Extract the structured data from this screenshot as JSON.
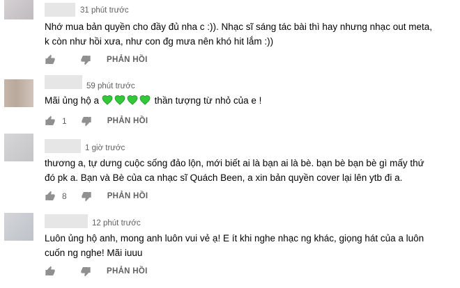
{
  "comments": [
    {
      "time": "31 phút trước",
      "lines": [
        "Nhớ mua bản quyền cho đầy đủ nha c :)). Nhạc sĩ sáng tác bài thì hay nhưng nhạc out meta,",
        "k còn như hồi xưa, như con đg mưa nên khó hit lắm :))"
      ],
      "likes": "",
      "reply_label": "PHẢN HỒI",
      "avatar_color": "#cbc6c8"
    },
    {
      "time": "59 phút trước",
      "text_before": "Mãi ủng hộ a",
      "text_after": "thần tượng từ nhỏ của e !",
      "emoji": [
        "green-heart",
        "green-heart",
        "green-heart",
        "green-heart"
      ],
      "likes": "1",
      "reply_label": "PHẢN HỒI",
      "avatar_color": "#c2b2a6"
    },
    {
      "time": "1 giờ trước",
      "lines": [
        "thương a, tự dưng cuộc sống đảo lộn, mới biết ai là bạn ai là bè. bạn bè bạn bè gì mấy thứ",
        "đó pk a. Bạn và Bè của ca nhạc sĩ Quách Been, a xin bản quyền cover lại lên ytb đi a."
      ],
      "likes": "8",
      "reply_label": "PHẢN HỒI",
      "avatar_color": "#cfcfd1"
    },
    {
      "time": "12 phút trước",
      "lines": [
        "Luôn ủng hộ anh, mong anh luôn vui vẻ ạ! E ít khi nghe nhạc ng khác, giọng hát của a luôn",
        "cuốn ng nghe! Mãi iuuu"
      ],
      "likes": "",
      "reply_label": "PHẢN HỒI",
      "avatar_color": "#c9cbd0"
    }
  ],
  "colors": {
    "heart": "#32c838",
    "secondary_text": "#606060",
    "name_placeholder": "#e6e6e6"
  }
}
